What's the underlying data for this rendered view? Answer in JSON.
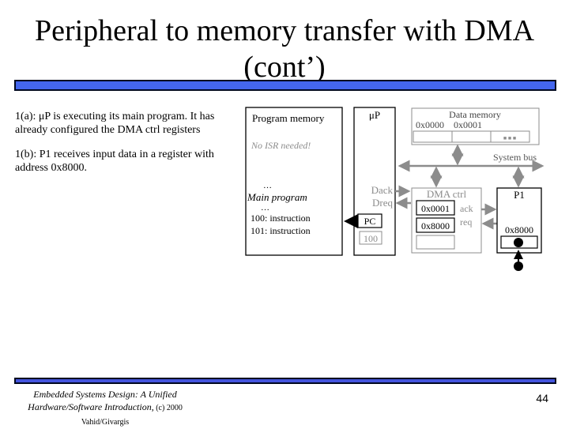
{
  "slide": {
    "title_line1": "Peripheral to memory transfer with DMA",
    "title_line2": "(cont’)",
    "steps": [
      {
        "line1": "1(a): μP is executing its main program. It has",
        "line2": "already configured the DMA ctrl registers"
      },
      {
        "line1": "1(b): P1 receives input data in a register with",
        "line2": "address 0x8000."
      }
    ],
    "footer_line1": "Embedded Systems Design: A Unified",
    "footer_line2_italic": "Hardware/Software Introduction,",
    "footer_line2_plain": " (c) 2000 Vahid/Givargis",
    "page_number": "44"
  },
  "diagram": {
    "program_memory": {
      "label": "Program memory",
      "note": "No ISR needed!",
      "dots1": "…",
      "main_program": "Main program",
      "dots2": "…",
      "lines": [
        "100:  instruction",
        "101:  instruction"
      ]
    },
    "up": {
      "label": "μP",
      "dack": "Dack",
      "dreq": "Dreq",
      "pc_label": "PC",
      "pc_value": "100"
    },
    "data_memory": {
      "label": "Data memory",
      "addr0": "0x0000",
      "addr1": "0x0001",
      "ellipsis": "■ ■ ■"
    },
    "system_bus": "System bus",
    "dma_ctrl": {
      "label": "DMA ctrl",
      "reg1": "0x0001",
      "reg2": "0x8000",
      "ack": "ack",
      "req": "req"
    },
    "p1": {
      "label": "P1",
      "register_addr": "0x8000"
    },
    "colors": {
      "active": "#000000",
      "inactive": "#8c8c8c",
      "title_bar": "#4466ee"
    }
  }
}
